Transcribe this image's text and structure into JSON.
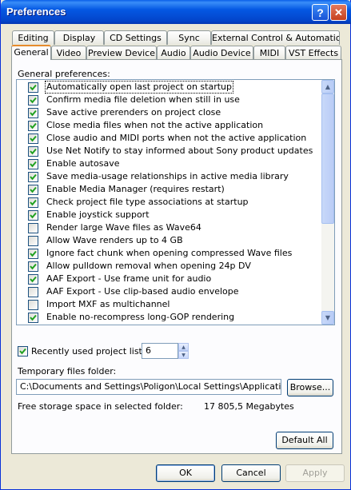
{
  "window": {
    "title": "Preferences"
  },
  "tabs_back": [
    "Editing",
    "Display",
    "CD Settings",
    "Sync",
    "External Control & Automation"
  ],
  "tabs_front": [
    "General",
    "Video",
    "Preview Device",
    "Audio",
    "Audio Device",
    "MIDI",
    "VST Effects"
  ],
  "active_tab": "General",
  "general": {
    "heading": "General preferences:",
    "options": [
      {
        "label": "Automatically open last project on startup",
        "checked": true,
        "selected": true
      },
      {
        "label": "Confirm media file deletion when still in use",
        "checked": true
      },
      {
        "label": "Save active prerenders on project close",
        "checked": true
      },
      {
        "label": "Close media files when not the active application",
        "checked": true
      },
      {
        "label": "Close audio and MIDI ports when not the active application",
        "checked": true
      },
      {
        "label": "Use Net Notify to stay informed about Sony product updates",
        "checked": true
      },
      {
        "label": "Enable autosave",
        "checked": true
      },
      {
        "label": "Save media-usage relationships in active media library",
        "checked": true
      },
      {
        "label": "Enable Media Manager (requires restart)",
        "checked": true
      },
      {
        "label": "Check project file type associations at startup",
        "checked": true
      },
      {
        "label": "Enable joystick support",
        "checked": true
      },
      {
        "label": "Render large Wave files as Wave64",
        "checked": false
      },
      {
        "label": "Allow Wave renders up to 4 GB",
        "checked": false
      },
      {
        "label": "Ignore fact chunk when opening compressed Wave files",
        "checked": true
      },
      {
        "label": "Allow pulldown removal when opening 24p DV",
        "checked": true
      },
      {
        "label": "AAF Export - Use frame unit for audio",
        "checked": true
      },
      {
        "label": "AAF Export - Use clip-based audio envelope",
        "checked": false
      },
      {
        "label": "Import MXF as multichannel",
        "checked": false
      },
      {
        "label": "Enable no-recompress long-GOP rendering",
        "checked": true
      }
    ]
  },
  "recent": {
    "label": "Recently used project list:",
    "checked": true,
    "value": "6"
  },
  "temp": {
    "label": "Temporary files folder:",
    "path": "C:\\Documents and Settings\\Poligon\\Local Settings\\Application Dat",
    "browse": "Browse...",
    "free_label": "Free storage space in selected folder:",
    "free_value": "17 805,5 Megabytes"
  },
  "buttons": {
    "default_all": "Default All",
    "ok": "OK",
    "cancel": "Cancel",
    "apply": "Apply"
  },
  "colors": {
    "title_bar": "#0458e3",
    "selection_outline": "#000000",
    "check_green": "#21a121",
    "active_tab_accent": "#e68b2c"
  }
}
